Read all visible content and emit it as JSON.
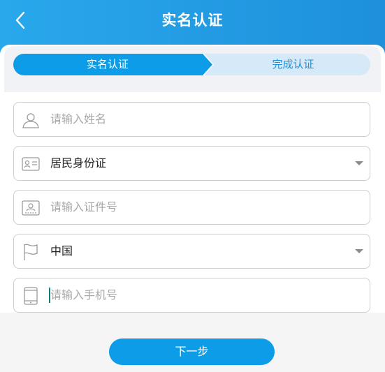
{
  "header": {
    "title": "实名认证"
  },
  "steps": [
    {
      "label": "实名认证",
      "active": true
    },
    {
      "label": "完成认证",
      "active": false
    }
  ],
  "form": {
    "name_placeholder": "请输入姓名",
    "id_type_value": "居民身份证",
    "id_number_placeholder": "请输入证件号",
    "country_value": "中国",
    "phone_placeholder": "请输入手机号"
  },
  "next_button": "下一步",
  "colors": {
    "header_start": "#29a8ec",
    "header_end": "#1e90dc",
    "accent": "#0d9ce8",
    "step_inactive_bg": "#d6e9f8",
    "step_inactive_text": "#1f8fd8"
  }
}
